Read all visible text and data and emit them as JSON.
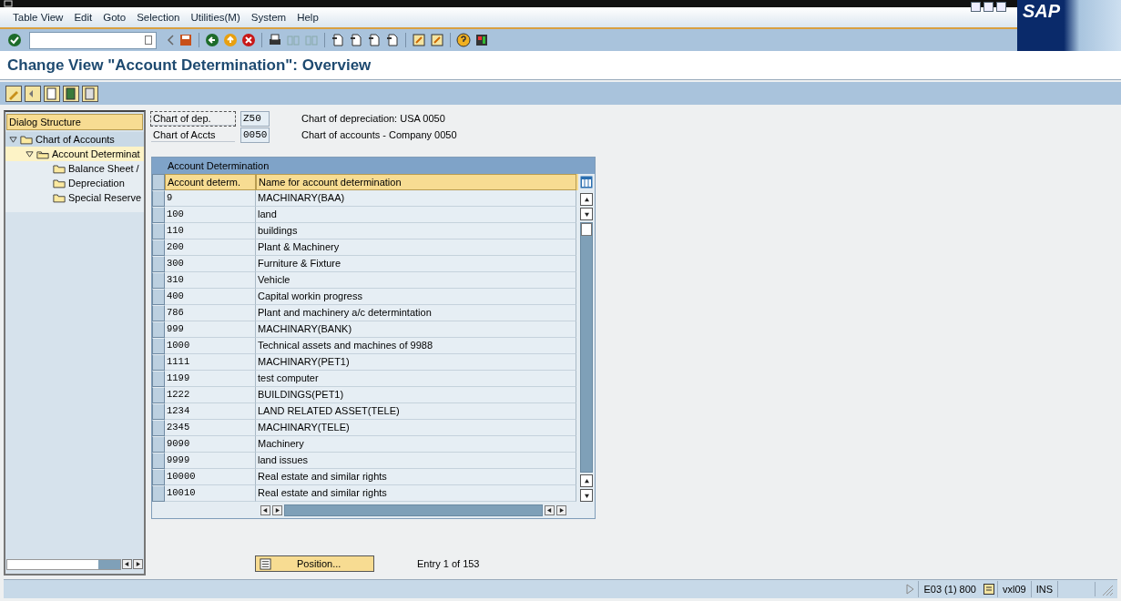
{
  "menu": [
    "Table View",
    "Edit",
    "Goto",
    "Selection",
    "Utilities(M)",
    "System",
    "Help"
  ],
  "logo": "SAP",
  "title": "Change View \"Account Determination\": Overview",
  "dialog_structure": {
    "title": "Dialog Structure",
    "items": [
      {
        "label": "Chart of Accounts",
        "expanded": true,
        "selected": false,
        "children": [
          {
            "label": "Account Determinat",
            "expanded": true,
            "selected": true,
            "children": [
              {
                "label": "Balance Sheet /",
                "selected": false
              },
              {
                "label": "Depreciation",
                "selected": false
              },
              {
                "label": "Special Reserve",
                "selected": false
              }
            ]
          }
        ]
      }
    ]
  },
  "fields": [
    {
      "label": "Chart of dep.",
      "value": "Z50",
      "description": "Chart of depreciation: USA 0050"
    },
    {
      "label": "Chart of Accts",
      "value": "0050",
      "description": "Chart of accounts - Company 0050"
    }
  ],
  "table": {
    "title": "Account Determination",
    "columns": [
      "Account determ.",
      "Name for account determination"
    ],
    "rows": [
      [
        "9",
        "MACHINARY(BAA)"
      ],
      [
        "100",
        "land"
      ],
      [
        "110",
        "buildings"
      ],
      [
        "200",
        "Plant & Machinery"
      ],
      [
        "300",
        "Furniture & Fixture"
      ],
      [
        "310",
        "Vehicle"
      ],
      [
        "400",
        "Capital workin progress"
      ],
      [
        "786",
        "Plant and machinery a/c determintation"
      ],
      [
        "999",
        "MACHINARY(BANK)"
      ],
      [
        "1000",
        "Technical assets and machines of 9988"
      ],
      [
        "1111",
        "MACHINARY(PET1)"
      ],
      [
        "1199",
        "test computer"
      ],
      [
        "1222",
        "BUILDINGS(PET1)"
      ],
      [
        "1234",
        "LAND RELATED ASSET(TELE)"
      ],
      [
        "2345",
        "MACHINARY(TELE)"
      ],
      [
        "9090",
        "Machinery"
      ],
      [
        "9999",
        "land issues"
      ],
      [
        "10000",
        "Real estate and similar rights"
      ],
      [
        "10010",
        "Real estate and similar rights"
      ]
    ]
  },
  "position_button": "Position...",
  "entry_info": "Entry 1 of 153",
  "status_bar": {
    "system": "E03 (1) 800",
    "server": "vxl09",
    "mode": "INS"
  }
}
